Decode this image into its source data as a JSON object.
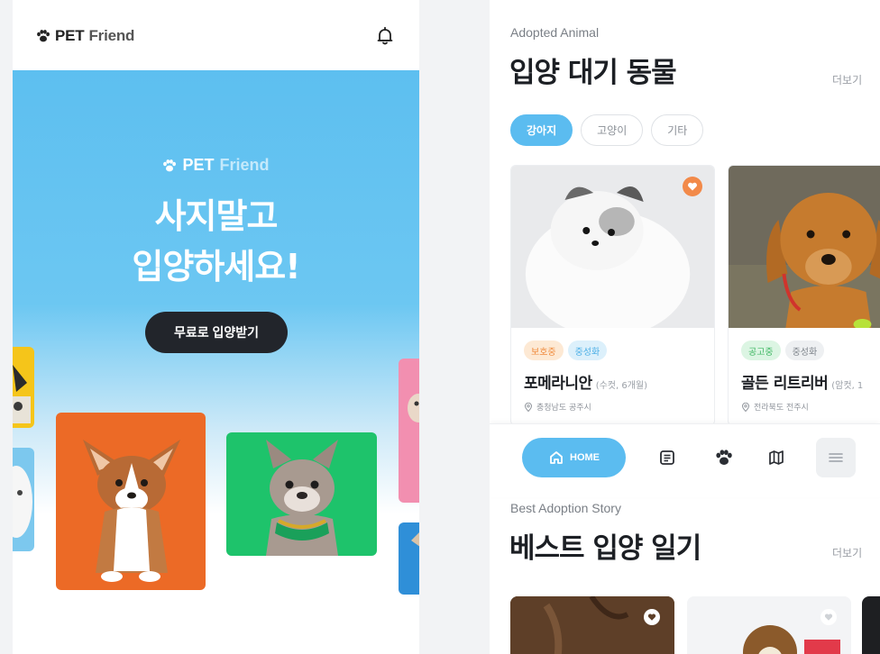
{
  "left": {
    "header": {
      "brand_pet": "PET",
      "brand_friend": "Friend"
    },
    "hero": {
      "brand_pet": "PET",
      "brand_friend": "Friend",
      "title_line1": "사지말고",
      "title_line2": "입양하세요!",
      "cta_label": "무료로 입양받기"
    }
  },
  "right": {
    "adopted": {
      "kicker": "Adopted Animal",
      "title": "입양 대기 동물",
      "more": "더보기",
      "chips": [
        {
          "label": "강아지",
          "active": true
        },
        {
          "label": "고양이",
          "active": false
        },
        {
          "label": "기타",
          "active": false
        }
      ],
      "cards": [
        {
          "tags": [
            "보호중",
            "중성화"
          ],
          "name": "포메라니안",
          "meta": "(수컷, 6개월)",
          "location": "충청남도 공주시"
        },
        {
          "tags": [
            "공고중",
            "중성화"
          ],
          "name": "골든 리트리버",
          "meta": "(암컷, 1",
          "location": "전라북도 전주시"
        }
      ]
    },
    "nav": {
      "home_label": "HOME"
    },
    "story": {
      "kicker": "Best Adoption Story",
      "title": "베스트 입양 일기",
      "more": "더보기"
    }
  },
  "colors": {
    "accent": "#5bbcf0",
    "dark_button": "#22252b",
    "orange_tag": "#f08a3c",
    "fav": "#f28a4a"
  }
}
